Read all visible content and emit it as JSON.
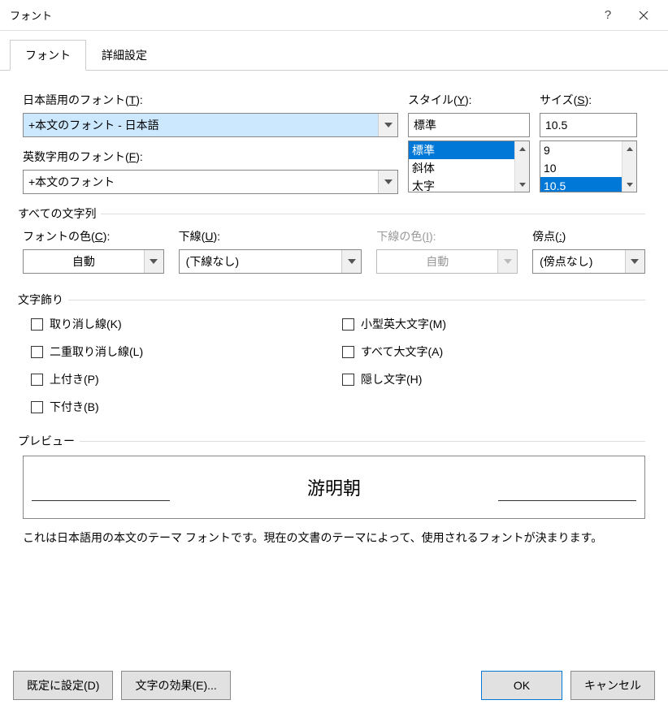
{
  "title": "フォント",
  "tabs": {
    "font": "フォント",
    "advanced": "詳細設定"
  },
  "jp_font": {
    "label_pre": "日本語用のフォント(",
    "key": "T",
    "label_post": "):",
    "value": "+本文のフォント - 日本語"
  },
  "latin_font": {
    "label_pre": "英数字用のフォント(",
    "key": "F",
    "label_post": "):",
    "value": "+本文のフォント"
  },
  "style": {
    "label_pre": "スタイル(",
    "key": "Y",
    "label_post": "):",
    "value": "標準",
    "options": [
      "標準",
      "斜体",
      "太字"
    ]
  },
  "size": {
    "label_pre": "サイズ(",
    "key": "S",
    "label_post": "):",
    "value": "10.5",
    "options": [
      "9",
      "10",
      "10.5"
    ]
  },
  "group_all_text": "すべての文字列",
  "font_color": {
    "label_pre": "フォントの色(",
    "key": "C",
    "label_post": "):",
    "value": "自動"
  },
  "underline": {
    "label_pre": "下線(",
    "key": "U",
    "label_post": "):",
    "value": "(下線なし)"
  },
  "underline_color": {
    "label_pre": "下線の色(",
    "key": "I",
    "label_post": "):",
    "value": "自動"
  },
  "emphasis": {
    "label_pre": "傍点(",
    "key": ":",
    "label_post": ")",
    "value": "(傍点なし)"
  },
  "group_effects": "文字飾り",
  "effects": {
    "strike": {
      "pre": "取り消し線(",
      "key": "K",
      "post": ")"
    },
    "dstrike": {
      "pre": "二重取り消し線(",
      "key": "L",
      "post": ")"
    },
    "sup": {
      "pre": "上付き(",
      "key": "P",
      "post": ")"
    },
    "sub": {
      "pre": "下付き(",
      "key": "B",
      "post": ")"
    },
    "smallcaps": {
      "pre": "小型英大文字(",
      "key": "M",
      "post": ")"
    },
    "allcaps": {
      "pre": "すべて大文字(",
      "key": "A",
      "post": ")"
    },
    "hidden": {
      "pre": "隠し文字(",
      "key": "H",
      "post": ")"
    }
  },
  "group_preview": "プレビュー",
  "preview_text": "游明朝",
  "preview_desc": "これは日本語用の本文のテーマ フォントです。現在の文書のテーマによって、使用されるフォントが決まります。",
  "buttons": {
    "default": {
      "pre": "既定に設定(",
      "key": "D",
      "post": ")"
    },
    "text_effects": {
      "pre": "文字の効果(",
      "key": "E",
      "post": ")..."
    },
    "ok": "OK",
    "cancel": "キャンセル"
  }
}
